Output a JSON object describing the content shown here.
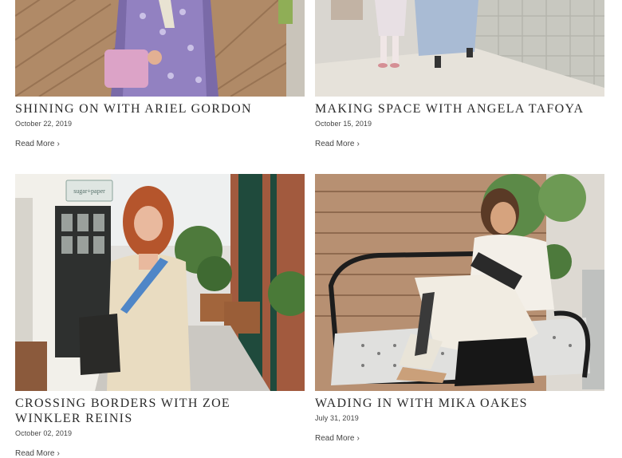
{
  "posts": [
    {
      "title": "SHINING ON WITH ARIEL GORDON",
      "date": "October 22, 2019",
      "read_more": "Read More",
      "chevron_icon": "chevron-right-icon"
    },
    {
      "title": "MAKING SPACE WITH ANGELA TAFOYA",
      "date": "October 15, 2019",
      "read_more": "Read More",
      "chevron_icon": "chevron-right-icon"
    },
    {
      "title": "CROSSING BORDERS WITH ZOE WINKLER REINIS",
      "date": "October 02, 2019",
      "read_more": "Read More",
      "chevron_icon": "chevron-right-icon"
    },
    {
      "title": "WADING IN WITH MIKA OAKES",
      "date": "July 31, 2019",
      "read_more": "Read More",
      "chevron_icon": "chevron-right-icon"
    }
  ],
  "images": {
    "sign_text": "sugar+paper"
  },
  "colors": {
    "title": "#2b2b2b",
    "meta": "#444444",
    "background": "#ffffff"
  }
}
